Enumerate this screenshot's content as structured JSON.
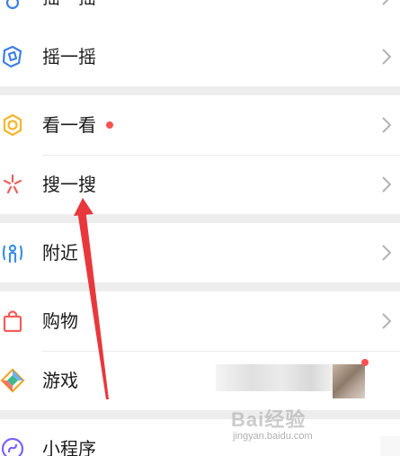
{
  "menu": {
    "top_item": {
      "label": "摇一摇"
    },
    "group2": [
      {
        "label": "摇一摇",
        "icon": "shake-icon",
        "color": "#3d7fe6"
      },
      {
        "label": "看一看",
        "icon": "look-icon",
        "color": "#f5b52a",
        "badge": "red-dot"
      },
      {
        "label": "搜一搜",
        "icon": "search-star-icon",
        "color": "#f25d5d"
      }
    ],
    "group3": [
      {
        "label": "附近",
        "icon": "location-person-icon",
        "color": "#3d8fe6"
      }
    ],
    "group4": [
      {
        "label": "购物",
        "icon": "shopping-bag-icon",
        "color": "#f25d5d"
      },
      {
        "label": "游戏",
        "icon": "game-diamond-icon",
        "color": "#f5a623"
      }
    ],
    "group5": [
      {
        "label": "小程序",
        "icon": "mini-program-icon",
        "color": "#7b61ff"
      }
    ]
  },
  "watermark": {
    "brand": "Bai经验",
    "url": "jingyan.baidu.com"
  },
  "colors": {
    "background": "#ededed",
    "surface": "#ffffff",
    "badge": "#fa5151",
    "annotation_arrow": "#e8383d"
  }
}
